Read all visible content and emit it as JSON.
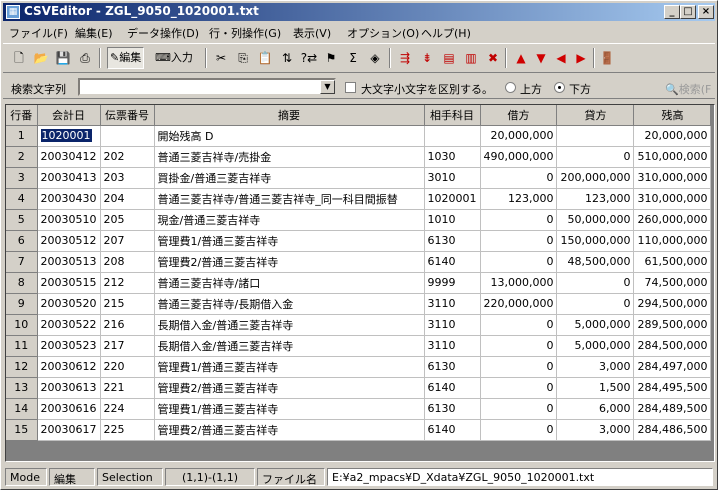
{
  "window": {
    "title": "CSVEditor - ZGL_9050_1020001.txt",
    "controls": {
      "minimize": "_",
      "maximize": "□",
      "close": "×"
    }
  },
  "menu": [
    "ファイル(F)",
    "編集(E)",
    "データ操作(D)",
    "行・列操作(G)",
    "表示(V)",
    "オプション(O)",
    "ヘルプ(H)"
  ],
  "toolbar": {
    "edit_label": "編集",
    "input_label": "入力",
    "sigma": "Σ"
  },
  "search": {
    "label": "検索文字列",
    "value": "",
    "case_label": "大文字小文字を区別する。",
    "up_label": "上方",
    "down_label": "下方",
    "search_button": "検索(F"
  },
  "grid": {
    "headers": [
      "行番",
      "会計日",
      "伝票番号",
      "摘要",
      "相手科目",
      "借方",
      "貸方",
      "残高"
    ],
    "rows": [
      [
        "1",
        "1020001",
        "",
        "開始残高 D",
        "",
        "20,000,000",
        "",
        "20,000,000"
      ],
      [
        "2",
        "20030412",
        "202",
        "普通三菱吉祥寺/売掛金",
        "1030",
        "490,000,000",
        "0",
        "510,000,000"
      ],
      [
        "3",
        "20030413",
        "203",
        "買掛金/普通三菱吉祥寺",
        "3010",
        "0",
        "200,000,000",
        "310,000,000"
      ],
      [
        "4",
        "20030430",
        "204",
        "普通三菱吉祥寺/普通三菱吉祥寺_同一科目間振替",
        "1020001",
        "123,000",
        "123,000",
        "310,000,000"
      ],
      [
        "5",
        "20030510",
        "205",
        "現金/普通三菱吉祥寺",
        "1010",
        "0",
        "50,000,000",
        "260,000,000"
      ],
      [
        "6",
        "20030512",
        "207",
        "管理費1/普通三菱吉祥寺",
        "6130",
        "0",
        "150,000,000",
        "110,000,000"
      ],
      [
        "7",
        "20030513",
        "208",
        "管理費2/普通三菱吉祥寺",
        "6140",
        "0",
        "48,500,000",
        "61,500,000"
      ],
      [
        "8",
        "20030515",
        "212",
        "普通三菱吉祥寺/諸口",
        "9999",
        "13,000,000",
        "0",
        "74,500,000"
      ],
      [
        "9",
        "20030520",
        "215",
        "普通三菱吉祥寺/長期借入金",
        "3110",
        "220,000,000",
        "0",
        "294,500,000"
      ],
      [
        "10",
        "20030522",
        "216",
        "長期借入金/普通三菱吉祥寺",
        "3110",
        "0",
        "5,000,000",
        "289,500,000"
      ],
      [
        "11",
        "20030523",
        "217",
        "長期借入金/普通三菱吉祥寺",
        "3110",
        "0",
        "5,000,000",
        "284,500,000"
      ],
      [
        "12",
        "20030612",
        "220",
        "管理費1/普通三菱吉祥寺",
        "6130",
        "0",
        "3,000",
        "284,497,000"
      ],
      [
        "13",
        "20030613",
        "221",
        "管理費2/普通三菱吉祥寺",
        "6140",
        "0",
        "1,500",
        "284,495,500"
      ],
      [
        "14",
        "20030616",
        "224",
        "管理費1/普通三菱吉祥寺",
        "6130",
        "0",
        "6,000",
        "284,489,500"
      ],
      [
        "15",
        "20030617",
        "225",
        "管理費2/普通三菱吉祥寺",
        "6140",
        "0",
        "3,000",
        "284,486,500"
      ]
    ]
  },
  "status": {
    "mode_label": "Mode",
    "mode_value": "編集",
    "selection_label": "Selection",
    "selection_value": "(1,1)-(1,1)",
    "file_label": "ファイル名",
    "file_value": "E:¥a2_mpacs¥D_Xdata¥ZGL_9050_1020001.txt"
  }
}
